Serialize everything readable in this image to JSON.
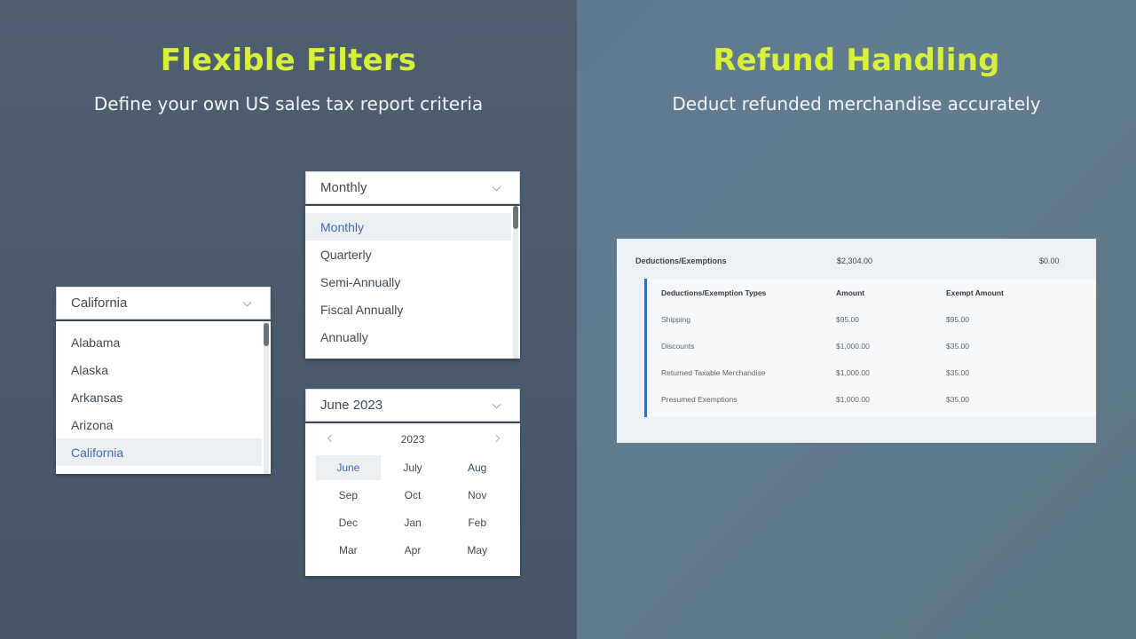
{
  "left": {
    "title": "Flexible Filters",
    "subtitle": "Define your own US sales tax report criteria",
    "state_select": {
      "value": "California",
      "options": [
        "Alabama",
        "Alaska",
        "Arkansas",
        "Arizona",
        "California"
      ],
      "selected_index": 4
    },
    "period_select": {
      "value": "Monthly",
      "options": [
        "Monthly",
        "Quarterly",
        "Semi-Annually",
        "Fiscal Annually",
        "Annually"
      ],
      "selected_index": 0
    },
    "month_picker": {
      "value": "June 2023",
      "year": "2023",
      "months": [
        "June",
        "July",
        "Aug",
        "Sep",
        "Oct",
        "Nov",
        "Dec",
        "Jan",
        "Feb",
        "Mar",
        "Apr",
        "May"
      ],
      "selected_index": 0
    }
  },
  "right": {
    "title": "Refund Handling",
    "subtitle": "Deduct refunded merchandise accurately",
    "summary": {
      "label": "Deductions/Exemptions",
      "amount": "$2,304.00",
      "exempt": "$0.00"
    },
    "table": {
      "headers": [
        "Deductions/Exemption Types",
        "Amount",
        "Exempt Amount"
      ],
      "rows": [
        [
          "Shipping",
          "$95.00",
          "$95.00"
        ],
        [
          "Discounts",
          "$1,000.00",
          "$35.00"
        ],
        [
          "Returned Taxable Merchandise",
          "$1,000.00",
          "$35.00"
        ],
        [
          "Presumed Exemptions",
          "$1,000.00",
          "$35.00"
        ]
      ]
    }
  },
  "colors": {
    "accent_title": "#d9f03a",
    "selected_text": "#4068b8",
    "left_bg": "#4e5f72",
    "right_bg": "#617c8f"
  },
  "icons": [
    "chevron-down-icon",
    "chevron-left-icon",
    "chevron-right-icon"
  ]
}
